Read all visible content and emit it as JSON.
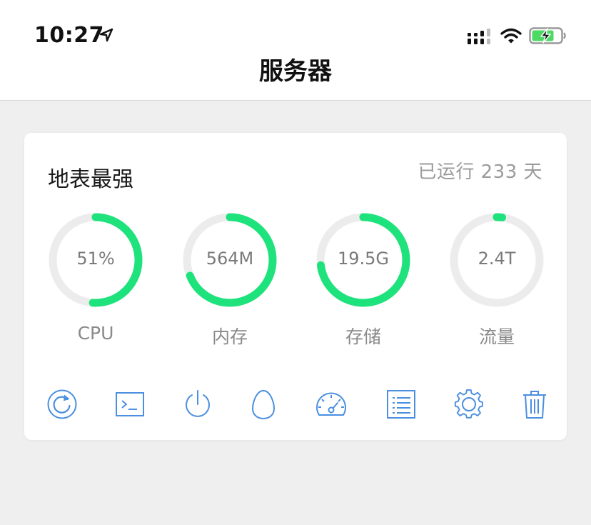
{
  "status_bar": {
    "time": "10:27",
    "icons": [
      "location-arrow-icon",
      "cellular-signal-icon",
      "wifi-icon",
      "battery-charging-icon"
    ]
  },
  "header": {
    "title": "服务器"
  },
  "server": {
    "name": "地表最强",
    "uptime": "已运行 233 天",
    "gauges": [
      {
        "label": "CPU",
        "value": "51%",
        "fraction": 0.51
      },
      {
        "label": "内存",
        "value": "564M",
        "fraction": 0.69
      },
      {
        "label": "存储",
        "value": "19.5G",
        "fraction": 0.73
      },
      {
        "label": "流量",
        "value": "2.4T",
        "fraction": 0.02
      }
    ],
    "actions": [
      "restart-icon",
      "terminal-icon",
      "power-icon",
      "egg-icon",
      "speedometer-icon",
      "list-icon",
      "settings-gear-icon",
      "trash-icon"
    ]
  },
  "colors": {
    "accent": "#4a8fe0",
    "gauge_fill": "#1ee27c",
    "gauge_track": "#ececec",
    "background": "#efefef",
    "card": "#ffffff"
  }
}
